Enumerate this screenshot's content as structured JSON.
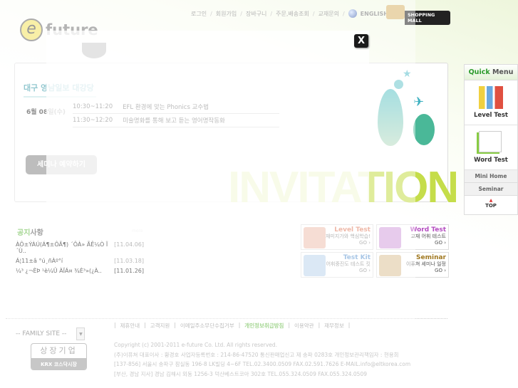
{
  "header": {
    "nav": [
      "로그인",
      "회원가입",
      "장바구니",
      "주문,배송조회",
      "교재문의"
    ],
    "english": "ENGLISH",
    "shopping_mall": "SHOPPING MALL",
    "logo_letter": "e",
    "logo_text": "future"
  },
  "banner": {
    "tab": "대구 영남일보 대강당",
    "date": "6월 08일(수)",
    "schedule": [
      {
        "time": "10:30~11:20",
        "title": "EFL 환경에 맞는 Phonics 교수법"
      },
      {
        "time": "11:30~12:20",
        "title": "미술명화를 통해 보고 듣는 영어명작동화"
      }
    ],
    "reserve_button": "세미나 예약하기",
    "invitation": "INVITATION"
  },
  "notice": {
    "title_a": "공지",
    "title_b": "사항",
    "more": "more",
    "items": [
      {
        "text": "ÀÔ±ÝÀÚ(Á¶±ÔÃ¶) ´ÔÀ» ÃÊ¼Ò Ï´Ù..",
        "date": "[11.04.06]"
      },
      {
        "text": "Á¦11±â °ú¸ñÀº°í",
        "date": "[11.03.18]"
      },
      {
        "text": "¼³ ¿¬ÈÞ ¹è¼Û ÀÏÁ¤ ¾È³»(¿À..",
        "date": "[11.01.26]"
      }
    ]
  },
  "cards": [
    {
      "title": "Level Test",
      "desc": "재미지가와 핵심학습!",
      "go": "GO ›",
      "color": "#e06040"
    },
    {
      "title": "Word Test",
      "desc": "교재 어휘 테스트",
      "go": "GO ›",
      "color": "#b44cc0"
    },
    {
      "title": "Test Kit",
      "desc": "어휘중진도 테스트 킷",
      "go": "GO ›",
      "color": "#4a88c8"
    },
    {
      "title": "Seminar",
      "desc": "이퓨쳐 세미나 일정",
      "go": "GO ›",
      "color": "#a07820"
    }
  ],
  "quick_menu": {
    "title_a": "Quick",
    "title_b": " Menu",
    "items": [
      "Level Test",
      "Word Test"
    ],
    "small": [
      "Mini Home",
      "Seminar"
    ],
    "top": "TOP"
  },
  "footer": {
    "family_site": "-- FAMILY SITE --",
    "krx_top": "상장기업",
    "krx_bottom": "KRX 코스닥시장",
    "links": [
      "제휴안내",
      "고객지원",
      "이메일주소무단수집거부",
      "개인정보취급방침",
      "이용약관",
      "재무정보"
    ],
    "copyright": [
      "Copyright (c) 2001-2011 e-future Co. Ltd. All rights reserved.",
      "(주)이퓨쳐  대표이사 : 황경호    사업자등록번호 : 214-86-47520    통신판매업신고 제 송파 0283호    개인정보관리책임자 : 현용희",
      "[137-856] 서울시 송파구 잠실동 196-8 LK빌딩 4~6F    TEL.02.3400.0509    FAX.02.591.7626    E-MAIL.info@eltkorea.com",
      "[부산, 경남 지사] 경남 김해시 외동 1256-3 덕산베스트코아 302호    TEL.055.324.0509    FAX.055.324.0509"
    ]
  },
  "popup": {
    "close": "X"
  }
}
